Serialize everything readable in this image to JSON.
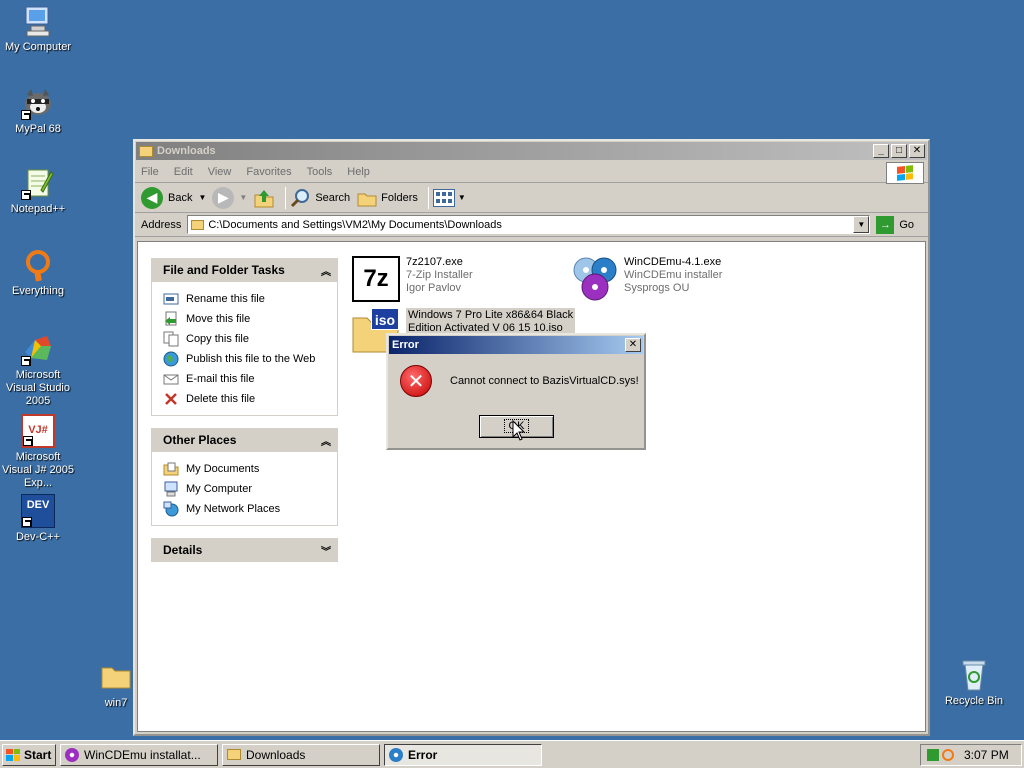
{
  "desktop": {
    "icons": [
      {
        "label": "My Computer",
        "icon": "my-computer-icon"
      },
      {
        "label": "MyPal 68",
        "icon": "mypal-icon"
      },
      {
        "label": "Notepad++",
        "icon": "notepadpp-icon"
      },
      {
        "label": "Everything",
        "icon": "everything-icon"
      },
      {
        "label": "Microsoft Visual Studio 2005",
        "icon": "visual-studio-icon"
      },
      {
        "label": "Microsoft Visual J# 2005 Exp...",
        "icon": "visual-jsharp-icon"
      },
      {
        "label": "Dev-C++",
        "icon": "devcpp-icon"
      },
      {
        "label": "win7",
        "icon": "folder-icon"
      },
      {
        "label": "Recycle Bin",
        "icon": "recycle-bin-icon"
      }
    ],
    "devcpp_badge": "DEV",
    "jsharp_badge": "VJ#"
  },
  "explorer": {
    "title": "Downloads",
    "menu": [
      "File",
      "Edit",
      "View",
      "Favorites",
      "Tools",
      "Help"
    ],
    "toolbar": {
      "back": "Back",
      "search": "Search",
      "folders": "Folders"
    },
    "address_label": "Address",
    "address_value": "C:\\Documents and Settings\\VM2\\My Documents\\Downloads",
    "go_label": "Go",
    "panels": {
      "file_tasks": {
        "title": "File and Folder Tasks",
        "items": [
          "Rename this file",
          "Move this file",
          "Copy this file",
          "Publish this file to the Web",
          "E-mail this file",
          "Delete this file"
        ]
      },
      "other_places": {
        "title": "Other Places",
        "items": [
          "My Documents",
          "My Computer",
          "My Network Places"
        ]
      },
      "details": {
        "title": "Details"
      }
    },
    "files": [
      {
        "name": "7z2107.exe",
        "line2": "7-Zip Installer",
        "line3": "Igor Pavlov",
        "badge": "7z"
      },
      {
        "name": "WinCDEmu-4.1.exe",
        "line2": "WinCDEmu installer",
        "line3": "Sysprogs OU"
      },
      {
        "name": "Windows 7 Pro Lite x86&64 Black",
        "line2": "Edition Activated V 06 15 10.iso",
        "badge": "iso"
      }
    ]
  },
  "dialog": {
    "title": "Error",
    "message": "Cannot connect to BazisVirtualCD.sys!",
    "ok": "OK"
  },
  "taskbar": {
    "start": "Start",
    "buttons": [
      "WinCDEmu installat...",
      "Downloads",
      "Error"
    ],
    "active_index": 2,
    "clock": "3:07 PM"
  }
}
